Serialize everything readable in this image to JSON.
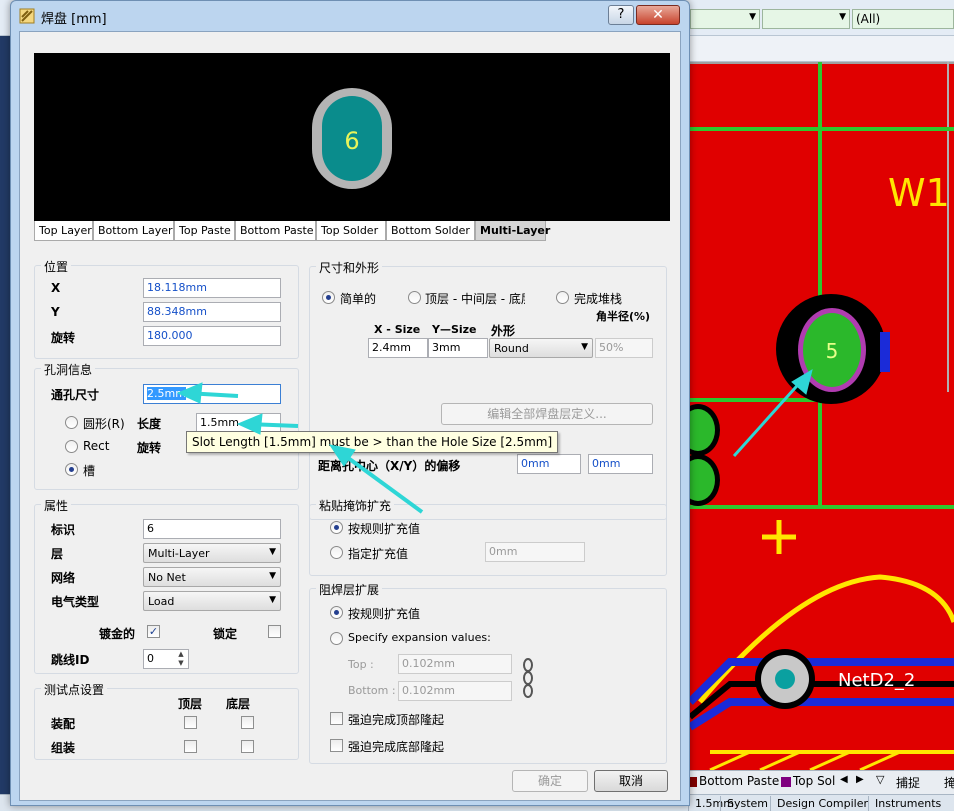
{
  "background": {
    "combo_all": "(All)",
    "pcb_labels": {
      "w1": "W1",
      "pad5": "5",
      "net": "NetD2_2",
      "plus": "+"
    },
    "layer_tabs": [
      {
        "label": "Bottom Paste",
        "color": "#800000"
      },
      {
        "label": "Top Sol",
        "color": "#800080"
      }
    ],
    "toolbar_right": [
      "捕捉",
      "掩"
    ],
    "bottom_tabs": [
      "1.5mm",
      "System",
      "Design Compiler",
      "Instruments"
    ]
  },
  "dialog": {
    "title": "焊盘 [mm]",
    "help_label": "?",
    "close_label": "✕",
    "preview": {
      "pad_number": "6"
    },
    "layer_tabs": [
      "Top Layer",
      "Bottom Layer",
      "Top Paste",
      "Bottom Paste",
      "Top Solder",
      "Bottom Solder",
      "Multi-Layer"
    ],
    "active_tab": "Multi-Layer",
    "position": {
      "title": "位置",
      "x_label": "X",
      "x_value": "18.118mm",
      "y_label": "Y",
      "y_value": "88.348mm",
      "rot_label": "旋转",
      "rot_value": "180.000"
    },
    "hole": {
      "title": "孔洞信息",
      "size_label": "通孔尺寸",
      "size_value": "2.5mm",
      "round_label": "圆形(R)",
      "rect_label": "Rect",
      "slot_label": "槽",
      "length_label": "长度",
      "length_value": "1.5mm",
      "rotation_label": "旋转"
    },
    "tooltip": "Slot Length [1.5mm] must be > than the Hole Size [2.5mm]",
    "props": {
      "title": "属性",
      "designator_label": "标识",
      "designator_value": "6",
      "layer_label": "层",
      "layer_value": "Multi-Layer",
      "net_label": "网络",
      "net_value": "No Net",
      "etype_label": "电气类型",
      "etype_value": "Load",
      "plated_label": "镀金的",
      "locked_label": "锁定",
      "jumper_label": "跳线ID",
      "jumper_value": "0"
    },
    "testpoint": {
      "title": "测试点设置",
      "top_label": "顶层",
      "bottom_label": "底层",
      "assembly_label": "装配",
      "fab_label": "组装"
    },
    "size_shape": {
      "title": "尺寸和外形",
      "simple_label": "简单的",
      "tmb_label": "顶层 - 中间层 - 底层",
      "fullstack_label": "完成堆栈",
      "corner_label": "角半径(%)",
      "col_x": "X - Size",
      "col_y": "Y—Size",
      "col_shape": "外形",
      "x_value": "2.4mm",
      "y_value": "3mm",
      "shape_value": "Round",
      "corner_value": "50%",
      "edit_btn": "编辑全部焊盘层定义...",
      "offset_label": "距离孔中心（X/Y）的偏移",
      "offset_x": "0mm",
      "offset_y": "0mm"
    },
    "paste": {
      "title": "粘贴掩饰扩充",
      "rule_label": "按规则扩充值",
      "specify_label": "指定扩充值",
      "value": "0mm"
    },
    "solder": {
      "title": "阻焊层扩展",
      "rule_label": "按规则扩充值",
      "specify_label": "Specify expansion values:",
      "top_label": "Top :",
      "top_value": "0.102mm",
      "bottom_label": "Bottom :",
      "bottom_value": "0.102mm",
      "force_top_label": "强迫完成顶部隆起",
      "force_bottom_label": "强迫完成底部隆起"
    },
    "ok_label": "确定",
    "cancel_label": "取消"
  }
}
